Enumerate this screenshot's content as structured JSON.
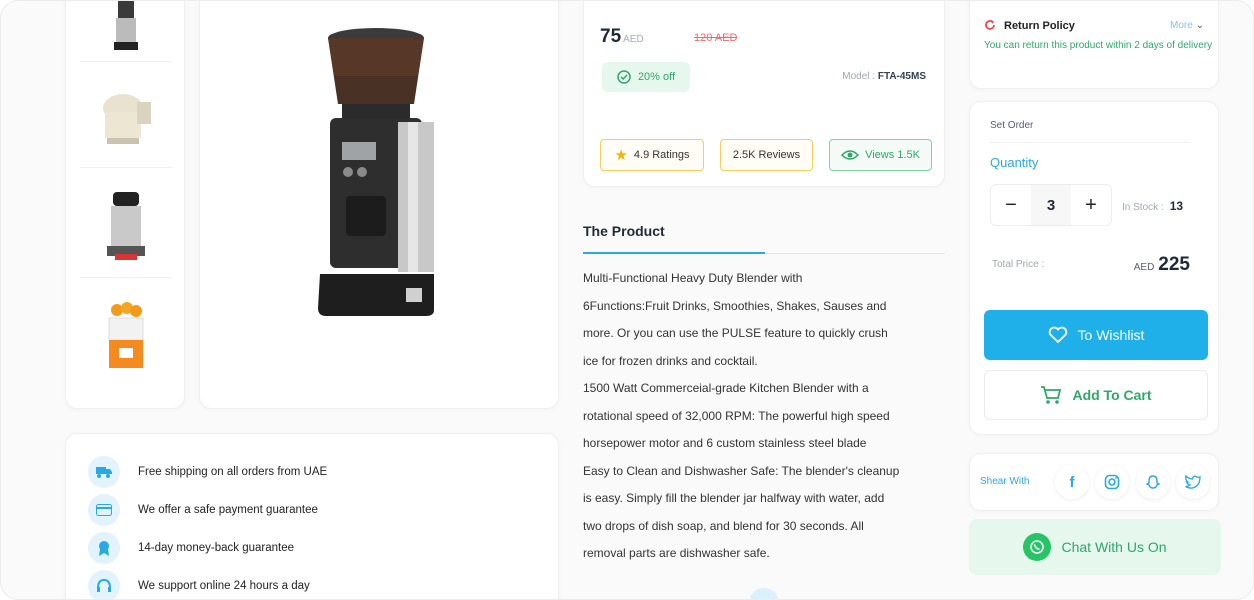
{
  "price": {
    "current": "75",
    "currency": "AED",
    "old": "120 AED"
  },
  "discount": {
    "label": "20% off"
  },
  "model": {
    "label": "Model :",
    "value": "FTA-45MS"
  },
  "stats": {
    "ratings": "4.9 Ratings",
    "reviews": "2.5K Reviews",
    "views": "Views 1.5K"
  },
  "product": {
    "title": "The Product",
    "lines": [
      "Multi-Functional Heavy Duty Blender with",
      "6Functions:Fruit Drinks, Smoothies, Shakes, Sauses and",
      "more. Or you can use the PULSE feature to quickly crush",
      "ice for frozen drinks and cocktail.",
      "1500 Watt Commerceial-grade Kitchen Blender with a",
      "rotational speed of 32,000 RPM: The powerful high speed",
      "horsepower motor and 6 custom stainless steel blade",
      "Easy to Clean and Dishwasher Safe: The blender's cleanup",
      "is easy. Simply fill the blender jar halfway with water, add",
      "two drops of dish soap, and blend for 30 seconds. All",
      "removal parts are dishwasher safe."
    ]
  },
  "features": [
    {
      "text": "Free shipping on all orders from UAE",
      "icon": "truck-icon"
    },
    {
      "text": "We offer a safe payment guarantee",
      "icon": "card-icon"
    },
    {
      "text": "14-day money-back guarantee",
      "icon": "badge-icon"
    },
    {
      "text": "We support online 24 hours a day",
      "icon": "headset-icon"
    }
  ],
  "return_policy": {
    "title": "Return Policy",
    "more": "More",
    "text": "You can return this product within 2 days of delivery"
  },
  "order": {
    "set_order": "Set Order",
    "quantity_label": "Quantity",
    "quantity": "3",
    "minus": "−",
    "plus": "+",
    "in_stock_label": "In Stock :",
    "in_stock": "13",
    "total_label": "Total Price :",
    "total_currency": "AED",
    "total": "225",
    "wishlist": "To Wishlist",
    "cart": "Add To Cart"
  },
  "share": {
    "label": "Shear With",
    "icons": [
      "facebook-icon",
      "instagram-icon",
      "snapchat-icon",
      "twitter-icon"
    ]
  },
  "chat": {
    "label": "Chat With Us On"
  },
  "colors": {
    "accent": "#1fb0ea",
    "green": "#2ea86a",
    "red": "#ef6b6b"
  }
}
